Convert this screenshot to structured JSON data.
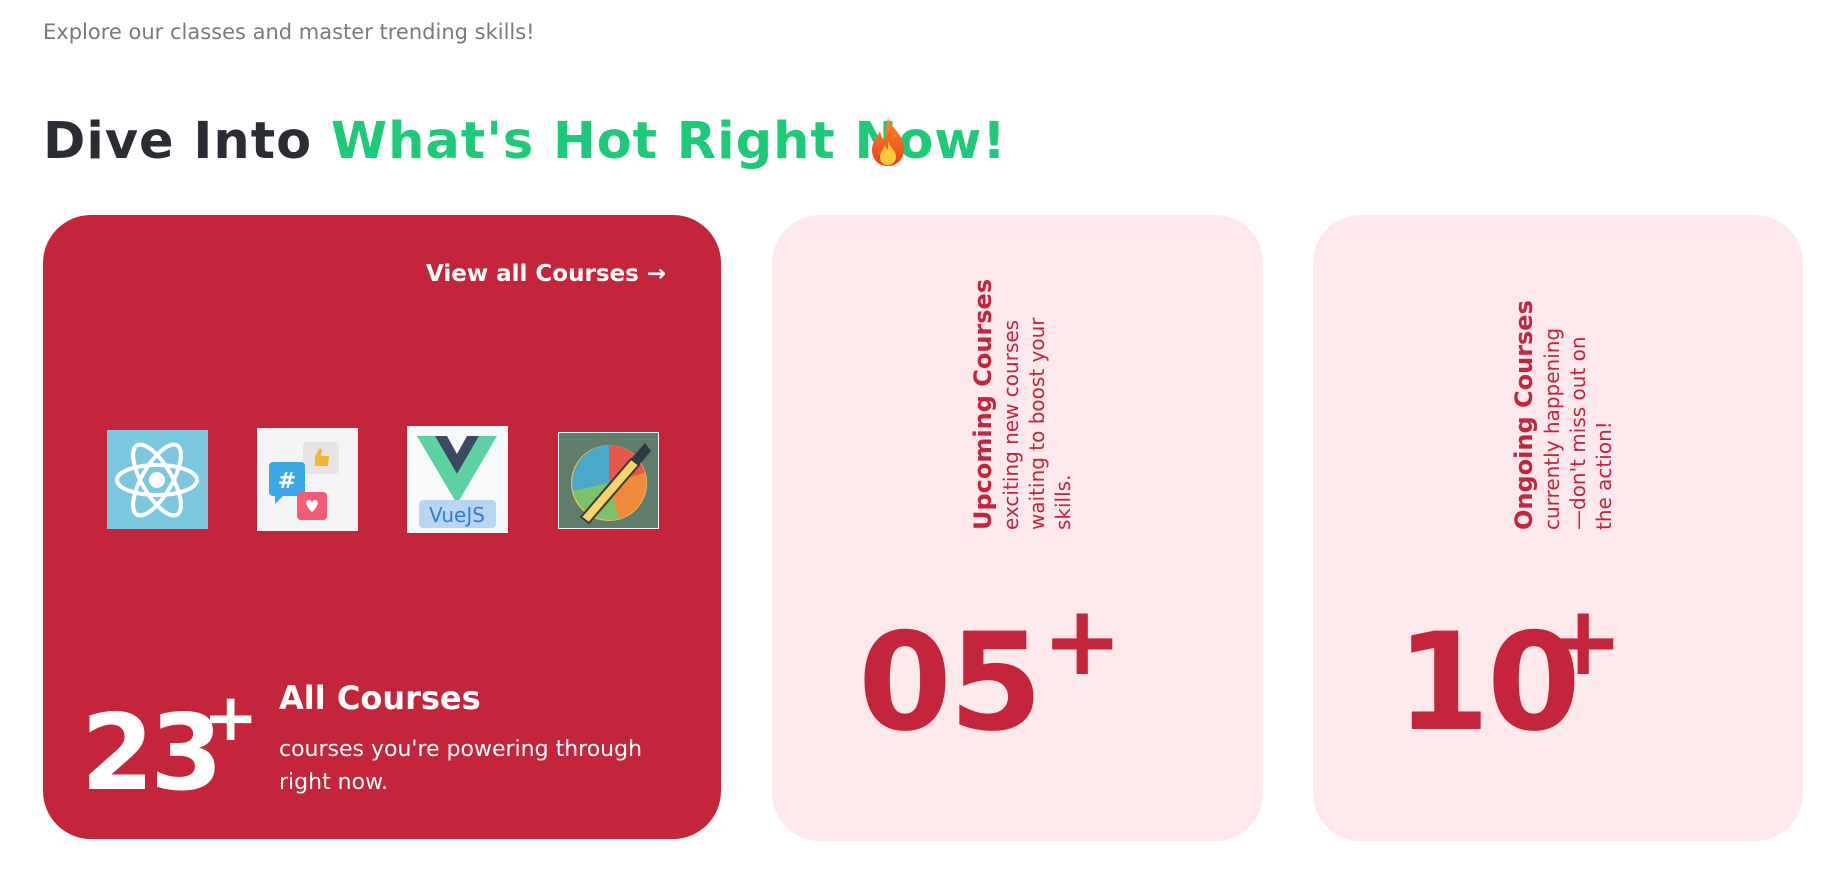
{
  "subtitle": "Explore our classes and master trending skills!",
  "heading": {
    "prefix": "Dive Into ",
    "highlight": "What's Hot Right Now!",
    "icon": "flame-icon"
  },
  "all_courses": {
    "view_all": "View all Courses →",
    "count": "23",
    "plus": "+",
    "title": "All Courses",
    "desc": "courses you're powering through right now.",
    "icons": [
      {
        "name": "react-icon",
        "label": ""
      },
      {
        "name": "social-media-icon",
        "label": "#"
      },
      {
        "name": "vuejs-icon",
        "label": "VueJS"
      },
      {
        "name": "design-pen-icon",
        "label": ""
      }
    ]
  },
  "upcoming": {
    "title": "Upcoming Courses",
    "desc": "exciting new courses waiting to boost your skills.",
    "count": "05",
    "plus": "+"
  },
  "ongoing": {
    "title": "Ongoing Courses",
    "desc": "currently happening—don't miss out on the action!",
    "count": "10",
    "plus": "+"
  },
  "colors": {
    "red": "#c4253a",
    "pink": "#fde8eb",
    "green": "#1ec97a",
    "dark": "#2a2d33",
    "gray": "#777a7f"
  }
}
